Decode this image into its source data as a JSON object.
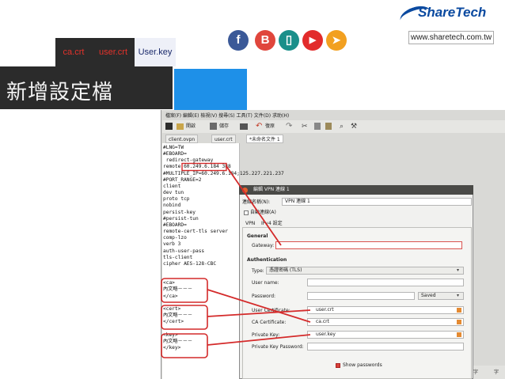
{
  "header": {
    "tabs": [
      "ca.crt",
      "user.crt",
      "User.key"
    ],
    "title": "新增設定檔",
    "url": "www.sharetech.com.tw",
    "logo": "ShareTech",
    "social": [
      {
        "name": "facebook-icon",
        "glyph": "f",
        "color": "#3b5998"
      },
      {
        "name": "blog-icon",
        "glyph": "B",
        "color": "#e0463c"
      },
      {
        "name": "mobile-icon",
        "glyph": "▯",
        "color": "#1a8f8a"
      },
      {
        "name": "youtube-icon",
        "glyph": "▶",
        "color": "#e22b2b"
      },
      {
        "name": "send-icon",
        "glyph": "➤",
        "color": "#f2a020"
      }
    ]
  },
  "editor": {
    "menubar": "檔案(F)  編輯(E)  檢視(V)  搜尋(S)  工具(T)  文件(D)  求助(H)",
    "toolbar": {
      "open": "開啟",
      "save": "儲存",
      "undo": "復原"
    },
    "tabs": [
      "client.ovpn",
      "user.crt",
      "*未命名文件 1"
    ],
    "lines": [
      "#LNG=TW",
      "#EBOARD=",
      " redirect-gateway",
      "remote 60.249.6.184 388",
      "#MULTIPLE_IP=60.249.6.184;125.227.221.237",
      "#PORT_RANGE=2",
      "client",
      "dev tun",
      "proto tcp",
      "nobind",
      "persist-key",
      "#persist-tun",
      "#EBOARD=",
      "remote-cert-tls server",
      "comp-lzo",
      "verb 3",
      "auth-user-pass",
      "tls-client",
      "cipher AES-128-CBC",
      "",
      "",
      "<ca>",
      "內文略－－－",
      "</ca>",
      "",
      "<cert>",
      "內文略－－－",
      "</cert>",
      "",
      "<key>",
      "內文略－－－",
      "</key>"
    ]
  },
  "dialog": {
    "title": "編輯 VPN 連線 1",
    "connection_name_label": "連線名稱(N):",
    "connection_name_value": "VPN 連線 1",
    "autoconnect_label": "自動連線(A)",
    "tabs": [
      "VPN",
      "IPv4 設定"
    ],
    "general_heading": "General",
    "gateway_label": "Gateway:",
    "gateway_value": "",
    "auth_heading": "Authentication",
    "type_label": "Type:",
    "type_value": "憑證密碼 (TLS)",
    "username_label": "User name:",
    "username_value": "",
    "password_label": "Password:",
    "password_value": "",
    "password_mode": "Saved",
    "user_cert_label": "User Certificate:",
    "user_cert_value": "user.crt",
    "ca_cert_label": "CA Certificate:",
    "ca_cert_value": "ca.crt",
    "private_key_label": "Private Key:",
    "private_key_value": "user.key",
    "private_key_password_label": "Private Key Password:",
    "private_key_password_value": "",
    "show_passwords_label": "Show passwords"
  },
  "status": {
    "ime": "字",
    "right": "字"
  }
}
